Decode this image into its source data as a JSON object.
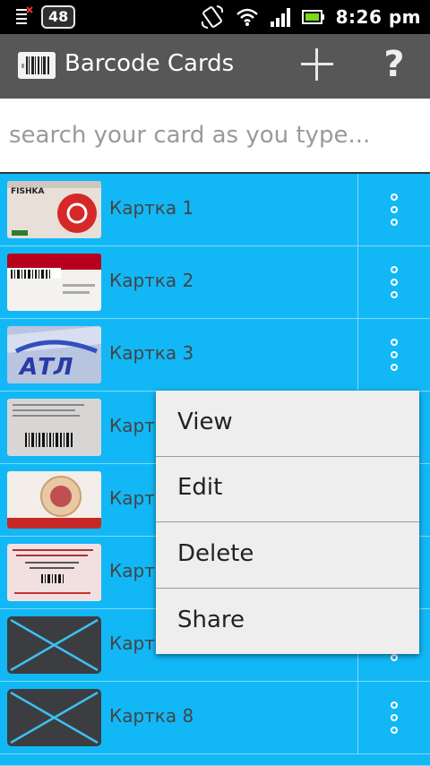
{
  "status_bar": {
    "notification_count": "48",
    "time": "8:26 pm"
  },
  "action_bar": {
    "title": "Barcode Cards",
    "add_icon": "plus-icon",
    "help_label": "?"
  },
  "search": {
    "placeholder": "search your card as you type...",
    "value": ""
  },
  "cards": [
    {
      "label": "Картка 1",
      "thumb": "fishka-card"
    },
    {
      "label": "Картка 2",
      "thumb": "barcode-red-card"
    },
    {
      "label": "Картка 3",
      "thumb": "atl-card"
    },
    {
      "label": "Картка 4",
      "thumb": "barcode-grey-card"
    },
    {
      "label": "Картка 5",
      "thumb": "medical-card"
    },
    {
      "label": "Картка 6",
      "thumb": "pink-card"
    },
    {
      "label": "Картка 7",
      "thumb": "placeholder-x"
    },
    {
      "label": "Картка 8",
      "thumb": "placeholder-x"
    }
  ],
  "context_menu": {
    "items": [
      "View",
      "Edit",
      "Delete",
      "Share"
    ]
  }
}
